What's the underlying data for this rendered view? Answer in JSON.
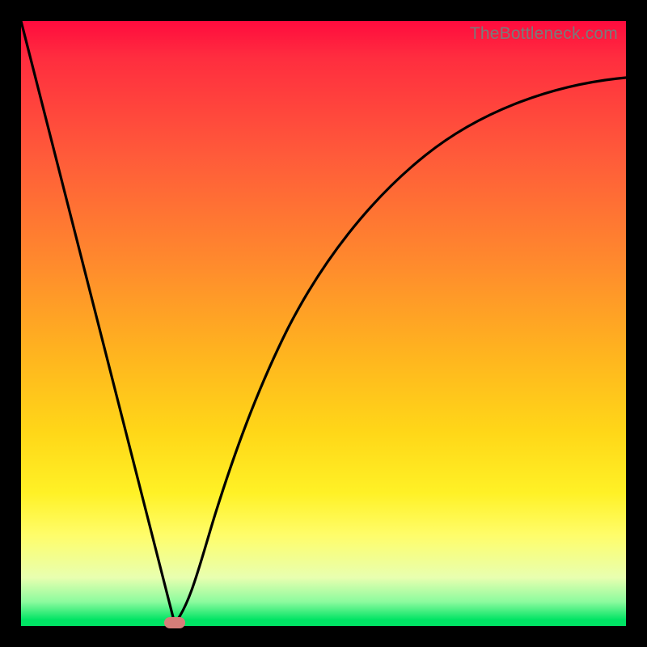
{
  "watermark": "TheBottleneck.com",
  "chart_data": {
    "type": "line",
    "title": "",
    "xlabel": "",
    "ylabel": "",
    "xlim": [
      0,
      100
    ],
    "ylim": [
      0,
      100
    ],
    "grid": false,
    "legend": false,
    "series": [
      {
        "name": "left-line",
        "x": [
          0,
          25
        ],
        "y": [
          100,
          0
        ]
      },
      {
        "name": "right-curve",
        "x": [
          25,
          30,
          35,
          40,
          46,
          53,
          62,
          72,
          83,
          92,
          100
        ],
        "y": [
          0,
          13,
          27,
          40,
          52,
          63,
          73,
          80,
          85,
          88,
          90
        ]
      }
    ],
    "marker": {
      "x": 25,
      "y": 0,
      "color": "#d67d79"
    },
    "background_gradient": {
      "top": "#ff0b3e",
      "mid_upper": "#ff8a2d",
      "mid": "#ffd718",
      "mid_lower": "#fffd6a",
      "bottom": "#00e464"
    }
  }
}
